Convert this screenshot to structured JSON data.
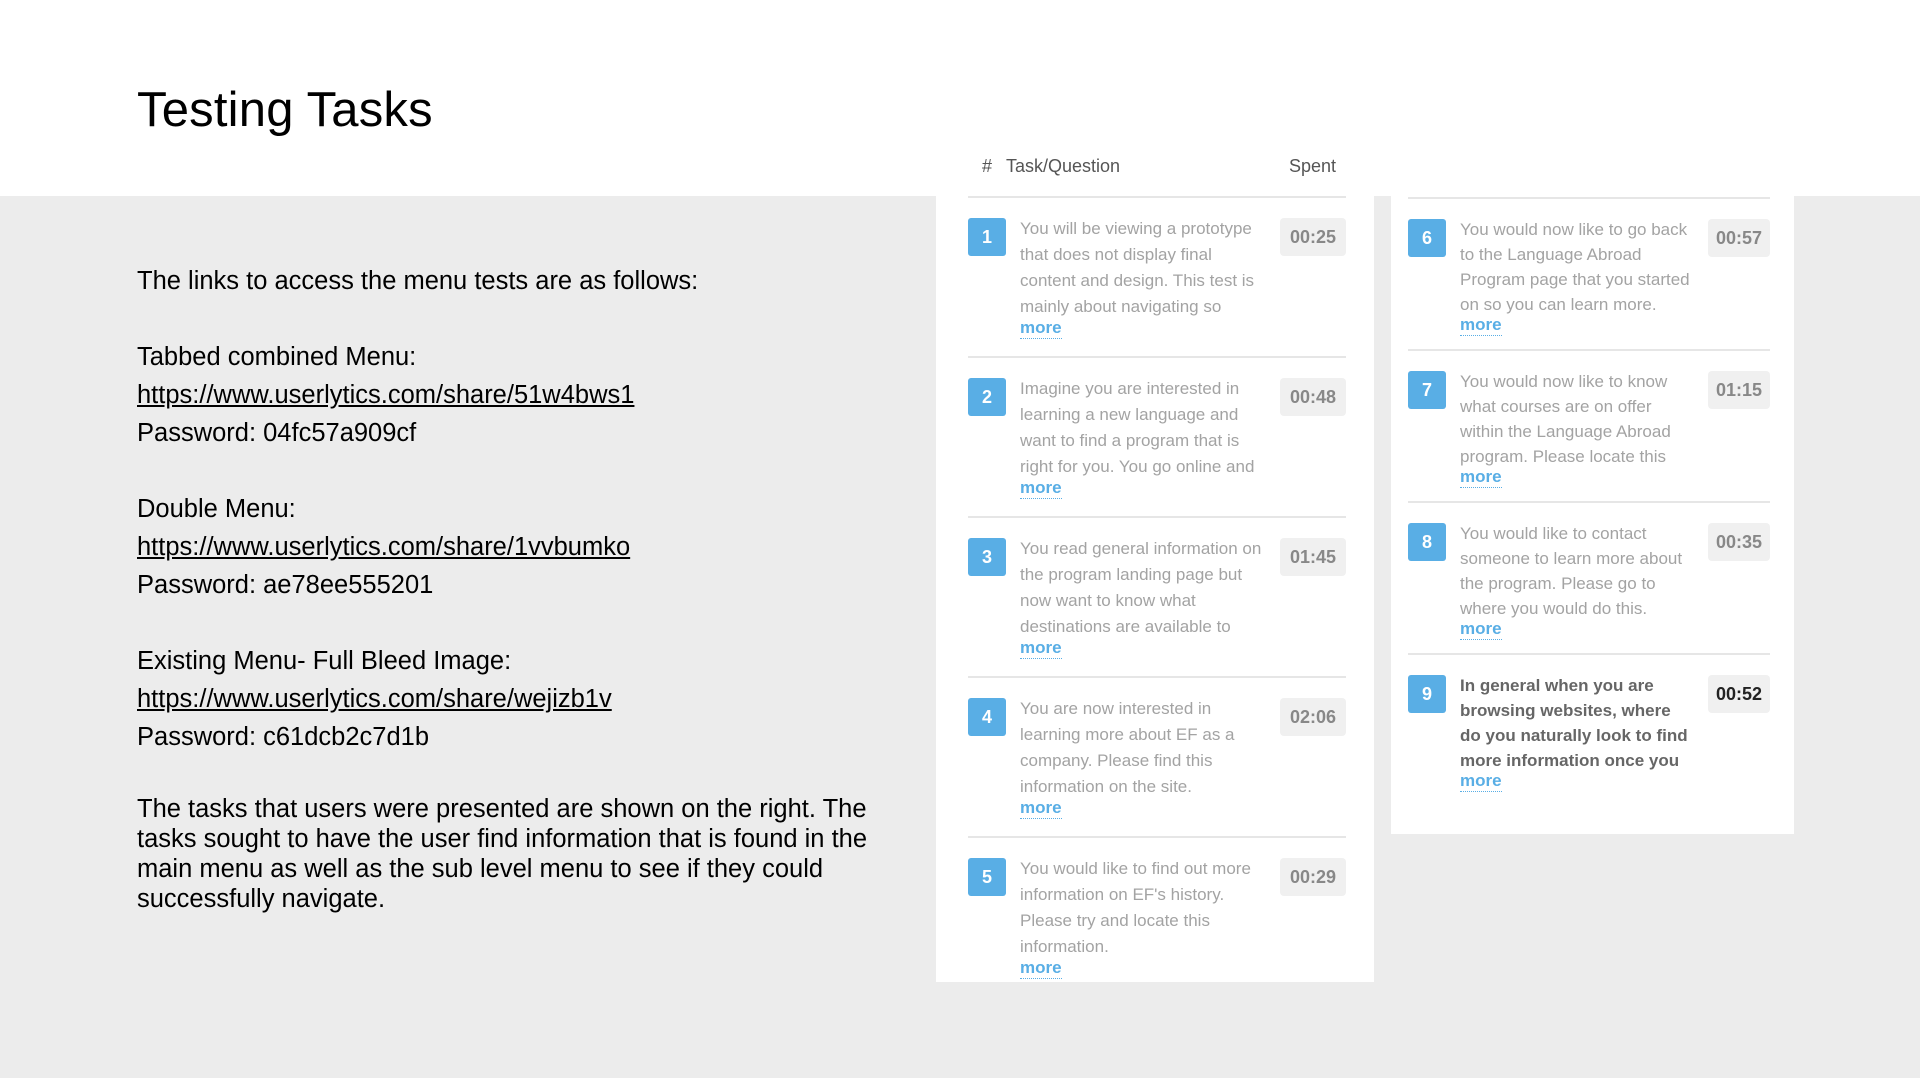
{
  "title": "Testing Tasks",
  "intro": "The links to access the menu tests are as follows:",
  "menus": [
    {
      "name": "Tabbed combined Menu:",
      "link": "https://www.userlytics.com/share/51w4bws1",
      "password": "Password: 04fc57a909cf"
    },
    {
      "name": "Double Menu:",
      "link": "https://www.userlytics.com/share/1vvbumko",
      "password": "Password: ae78ee555201"
    },
    {
      "name": "Existing Menu- Full Bleed Image:",
      "link": "https://www.userlytics.com/share/wejizb1v",
      "password": "Password: c61dcb2c7d1b"
    }
  ],
  "outro": "The tasks that users were presented are shown on the right. The tasks sought to have the user find information that is found in the main menu as well as the sub level menu to see if they could successfully navigate.",
  "table": {
    "hash": "#",
    "task_header": "Task/Question",
    "spent_header": "Spent",
    "more_label": "more",
    "accent": "#59aee5",
    "tasks": [
      {
        "num": "1",
        "text": "You will be viewing a prototype that does not display final content and design. This test is mainly about navigating so",
        "time": "00:25"
      },
      {
        "num": "2",
        "text": "Imagine you are interested in learning a new language and want to find a program that is right for you. You go online and",
        "time": "00:48"
      },
      {
        "num": "3",
        "text": "You read general information on the program landing page but now want to know what destinations are available to",
        "time": "01:45"
      },
      {
        "num": "4",
        "text": "You are now interested in learning more about EF as a company. Please find this information on the site.",
        "time": "02:06"
      },
      {
        "num": "5",
        "text": "You would like to find out more information on EF's history. Please try and locate this information.",
        "time": "00:29"
      },
      {
        "num": "6",
        "text": "You would now like to go back to the Language Abroad Program page that you started on so you can learn more.",
        "time": "00:57"
      },
      {
        "num": "7",
        "text": "You would now like to know what courses are on offer within the Language Abroad program. Please locate this",
        "time": "01:15"
      },
      {
        "num": "8",
        "text": "You would like to contact someone to learn more about the program. Please go to where you would do this.",
        "time": "00:35"
      },
      {
        "num": "9",
        "text": "In general when you are browsing websites, where do you naturally look to find more information once you",
        "time": "00:52"
      }
    ]
  }
}
